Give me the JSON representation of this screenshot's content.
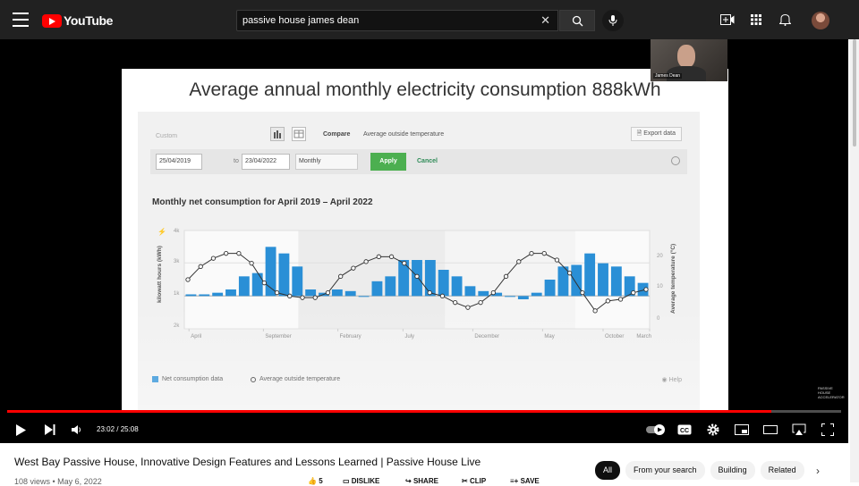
{
  "header": {
    "logo_text": "YouTube",
    "search_value": "passive house james dean",
    "icons": [
      "menu-icon",
      "create-icon",
      "apps-icon",
      "notifications-icon",
      "avatar"
    ]
  },
  "slide": {
    "title": "Average annual monthly electricity consumption 888kWh",
    "controls": {
      "dropdown": "Custom",
      "compare_label": "Compare",
      "compare_value": "Average outside temperature",
      "export_label": "Export data",
      "from_date": "25/04/2019",
      "to_label": "to",
      "to_date": "23/04/2022",
      "period": "Monthly",
      "apply_label": "Apply",
      "cancel_label": "Cancel",
      "help_label": "Help"
    },
    "webcam_name": "James Dean",
    "watermark": "PASSIVE HOUSE ACCELERATOR"
  },
  "chart_data": {
    "type": "bar",
    "title": "Monthly net consumption for April 2019 – April 2022",
    "ylabel": "kilowatt hours (kWh)",
    "y2label": "Average temperature (°C)",
    "y_ticks": [
      "4k",
      "3k",
      "1k",
      "2k"
    ],
    "y2_ticks": [
      "20",
      "10",
      "0"
    ],
    "x_tick_labels": [
      "April",
      "September",
      "February",
      "July",
      "December",
      "May",
      "October",
      "March"
    ],
    "series": [
      {
        "name": "Net consumption data",
        "values": [
          0.05,
          0.05,
          0.1,
          0.2,
          0.6,
          0.7,
          1.5,
          1.3,
          0.9,
          0.2,
          0.1,
          0.2,
          0.15,
          0,
          0.45,
          0.6,
          1.1,
          1.1,
          1.1,
          0.8,
          0.6,
          0.3,
          0.15,
          0.1,
          0,
          -0.1,
          0.1,
          0.5,
          0.9,
          0.95,
          1.3,
          1.0,
          0.9,
          0.6,
          0.4
        ]
      },
      {
        "name": "Average outside temperature",
        "values": [
          10,
          14,
          16.5,
          18,
          18,
          15,
          9,
          6,
          5,
          4.5,
          4.5,
          6,
          11,
          13.5,
          15.5,
          17,
          17,
          15,
          11,
          6,
          5,
          3,
          1.5,
          3,
          6,
          11,
          15.5,
          18,
          18,
          16,
          12,
          6,
          0.5,
          3.5,
          4,
          6,
          7
        ]
      }
    ]
  },
  "player": {
    "time": "23:02 / 25:08",
    "progress": 0.916
  },
  "video": {
    "title": "West Bay Passive House, Innovative Design Features and Lessons Learned | Passive House Live",
    "meta": "108 views • May 6, 2022",
    "actions": [
      "5",
      "DISLIKE",
      "SHARE",
      "CLIP",
      "SAVE"
    ],
    "chips": [
      "All",
      "From your search",
      "Building",
      "Related"
    ]
  }
}
